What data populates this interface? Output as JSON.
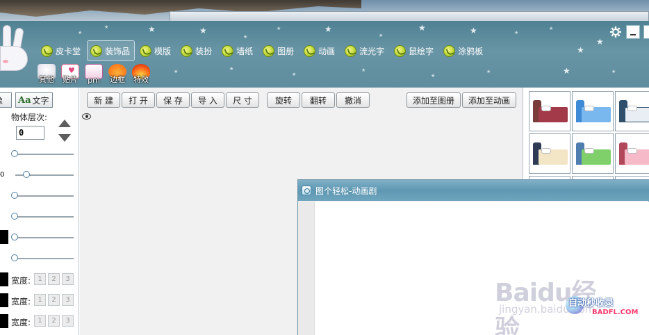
{
  "nav": {
    "tabs": [
      {
        "label": "皮卡堂"
      },
      {
        "label": "装饰品"
      },
      {
        "label": "模版"
      },
      {
        "label": "装扮"
      },
      {
        "label": "墙纸"
      },
      {
        "label": "图册"
      },
      {
        "label": "动画"
      },
      {
        "label": "流光字"
      },
      {
        "label": "鼠绘字"
      },
      {
        "label": "涂鸦板"
      }
    ],
    "active_tab": "装饰品",
    "sub_tabs": [
      {
        "label": "其他",
        "icon": "bunny-icon"
      },
      {
        "label": "贴片",
        "icon": "card-icon"
      },
      {
        "label": "pm",
        "icon": "gift-icon"
      },
      {
        "label": "边框",
        "icon": "pumpkin-icon"
      },
      {
        "label": "特效",
        "icon": "fire-icon"
      }
    ]
  },
  "left_panel": {
    "tab_image_fragment": "像",
    "tab_text": "文字",
    "layer_label": "物体层次:",
    "layer_value": "0",
    "zero_fragment": "0",
    "width_label": "宽度:",
    "width_options": [
      "1",
      "2",
      "3"
    ]
  },
  "toolbar": {
    "new": "新 建",
    "open": "打 开",
    "save": "保 存",
    "import": "导 入",
    "size": "尺 寸",
    "rotate": "旋转",
    "flip": "翻转",
    "undo": "撤消",
    "add_to_album": "添加至图册",
    "add_to_animation": "添加至动画"
  },
  "dialog": {
    "title": "图个轻松-动画剧"
  },
  "watermarks": {
    "baidu_main": "Baidu经验",
    "baidu_sub": "jingyan.baidu.com",
    "site_name": "自动秒收录",
    "site_domain": "BADFL.COM"
  },
  "colors": {
    "header_bg": "#5f8d9e",
    "dialog_titlebar": "#6fa5be",
    "button_border": "#8e969c"
  }
}
